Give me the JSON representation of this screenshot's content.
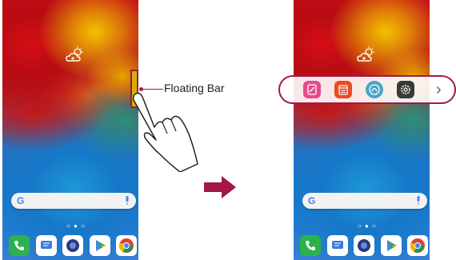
{
  "callout": {
    "label": "Floating Bar"
  },
  "search": {
    "logo": "G"
  },
  "home": {
    "page_dots": "○ ● ○"
  },
  "dock_apps": [
    "phone-icon",
    "messages-icon",
    "camera-icon",
    "play-store-icon",
    "chrome-icon"
  ],
  "floating_bar": {
    "items": [
      "note-icon",
      "calendar-icon",
      "app-icon",
      "settings-icon"
    ],
    "next": "›"
  },
  "colors": {
    "accent": "#a3174a"
  }
}
